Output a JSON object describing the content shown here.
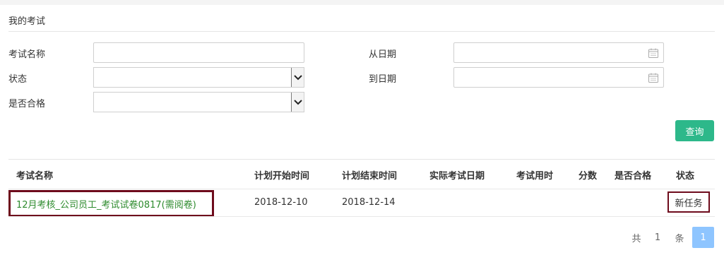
{
  "page": {
    "title": "我的考试"
  },
  "filters": {
    "exam_name_label": "考试名称",
    "status_label": "状态",
    "passed_label": "是否合格",
    "from_date_label": "从日期",
    "to_date_label": "到日期",
    "exam_name_value": "",
    "status_value": "",
    "passed_value": "",
    "from_date_value": "",
    "to_date_value": "",
    "query_button": "查询"
  },
  "table": {
    "headers": [
      "考试名称",
      "计划开始时间",
      "计划结束时间",
      "实际考试日期",
      "考试用时",
      "分数",
      "是否合格",
      "状态"
    ],
    "rows": [
      {
        "exam_name": "12月考核_公司员工_考试试卷0817(需阅卷)",
        "plan_start": "2018-12-10",
        "plan_end": "2018-12-14",
        "actual_date": "",
        "duration": "",
        "score": "",
        "passed": "",
        "status": "新任务"
      }
    ]
  },
  "pagination": {
    "total_prefix": "共",
    "total_count": "1",
    "total_suffix": "条",
    "current_page": "1"
  },
  "colors": {
    "accent_green": "#2db88a",
    "link_green": "#2e8b2e",
    "highlight_border": "#6e0b1c",
    "page_active": "#8ec5ff"
  },
  "icons": {
    "date_picker": "calendar-icon",
    "select_arrow": "chevron-down-icon"
  }
}
